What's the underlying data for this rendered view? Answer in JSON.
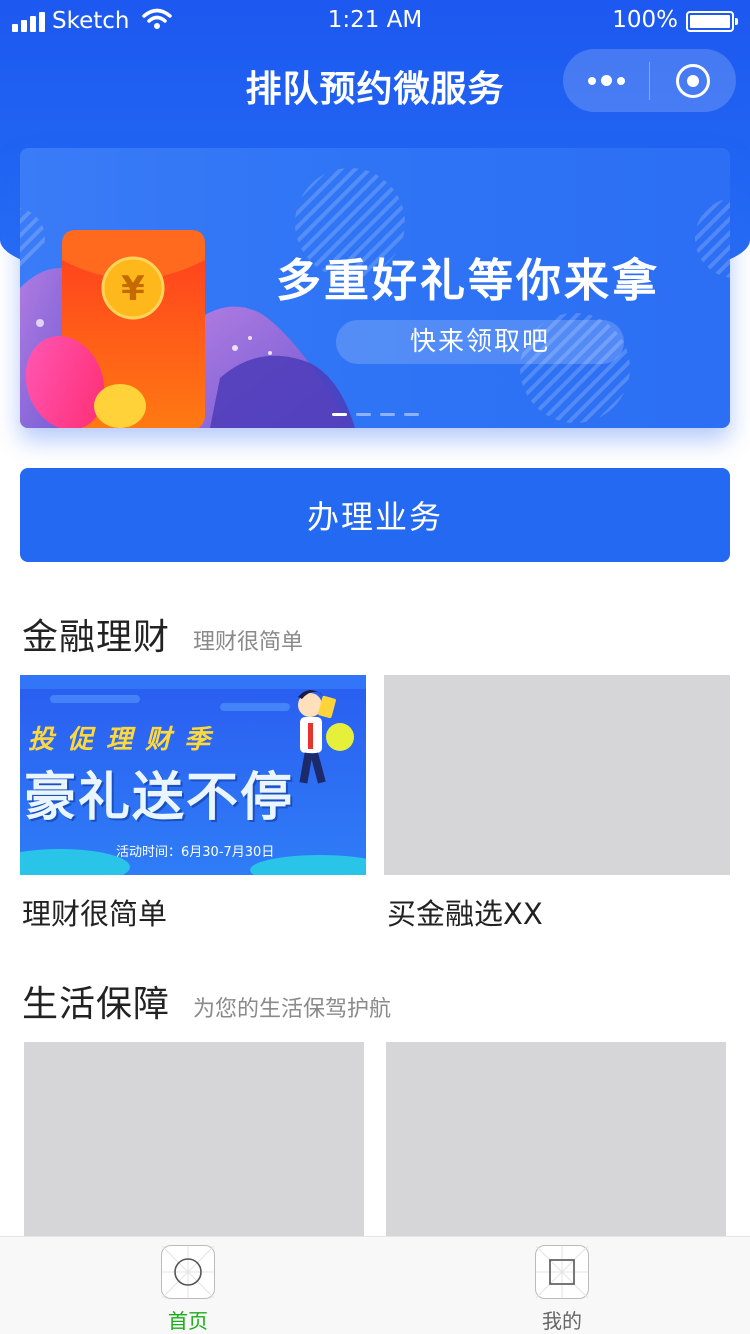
{
  "status_bar": {
    "carrier": "Sketch",
    "time": "1:21 AM",
    "battery": "100%"
  },
  "nav": {
    "title": "排队预约微服务"
  },
  "banner": {
    "headline": "多重好礼等你来拿",
    "button": "快来领取吧",
    "currency_symbol": "¥",
    "slide_count": 4,
    "active_slide": 1
  },
  "primary_button": {
    "label": "办理业务"
  },
  "finance": {
    "title": "金融理财",
    "subtitle": "理财很简单",
    "cards": [
      {
        "label": "理财很简单",
        "promo": {
          "line1": "投 促 理 财 季",
          "line2": "豪礼送不停",
          "line3": "活动时间：6月30-7月30日"
        }
      },
      {
        "label": "买金融选XX"
      }
    ]
  },
  "life": {
    "title": "生活保障",
    "subtitle": "为您的生活保驾护航"
  },
  "tabbar": {
    "items": [
      {
        "label": "首页",
        "active": true,
        "icon": "circle-icon"
      },
      {
        "label": "我的",
        "active": false,
        "icon": "square-icon"
      }
    ],
    "active_color": "#1aad19",
    "inactive_color": "#666666"
  },
  "colors": {
    "brand_blue": "#2469f2",
    "placeholder_gray": "#d6d5d8"
  }
}
